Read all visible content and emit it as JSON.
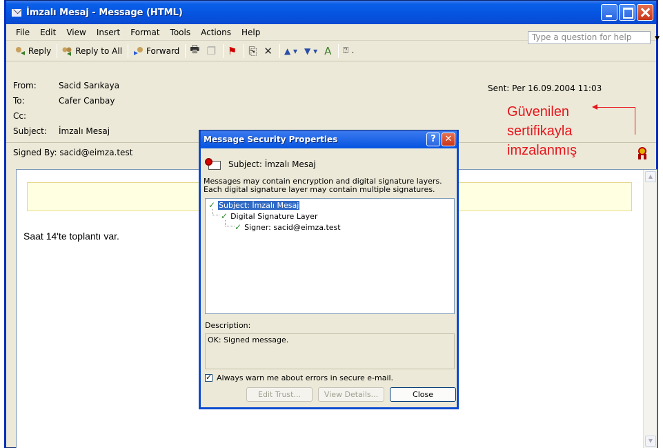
{
  "window": {
    "title": "İmzalı Mesaj - Message (HTML)"
  },
  "menu": {
    "items": [
      "File",
      "Edit",
      "View",
      "Insert",
      "Format",
      "Tools",
      "Actions",
      "Help"
    ],
    "help_placeholder": "Type a question for help"
  },
  "toolbar": {
    "reply": "Reply",
    "reply_all": "Reply to All",
    "forward": "Forward"
  },
  "header": {
    "from_label": "From:",
    "from_value": "Sacid Sarıkaya",
    "to_label": "To:",
    "to_value": "Cafer Canbay",
    "cc_label": "Cc:",
    "cc_value": "",
    "subject_label": "Subject:",
    "subject_value": "İmzalı Mesaj",
    "sent": "Sent: Per 16.09.2004 11:03",
    "signed_label": "Signed By:",
    "signed_value": "sacid@eimza.test"
  },
  "annotation": {
    "line1": "Güvenilen",
    "line2": "sertifikayla",
    "line3": "imzalanmış"
  },
  "body": {
    "text": "Saat 14'te toplantı var."
  },
  "dialog": {
    "title": "Message Security Properties",
    "subject": "Subject:  İmzalı Mesaj",
    "message": "Messages may contain encryption and digital signature layers.  Each digital signature layer may contain multiple signatures.",
    "tree": {
      "root": "Subject: İmzalı Mesaj",
      "layer": "Digital Signature Layer",
      "signer": "Signer: sacid@eimza.test"
    },
    "description_label": "Description:",
    "description": "OK: Signed message.",
    "always_warn": "Always warn me about errors in secure e-mail.",
    "always_warn_checked": true,
    "buttons": {
      "edit_trust": "Edit Trust...",
      "view_details": "View Details...",
      "close": "Close"
    }
  },
  "colors": {
    "annotation": "#e8141c",
    "titlebar": "#0553e0",
    "check": "#2a8a2a"
  }
}
